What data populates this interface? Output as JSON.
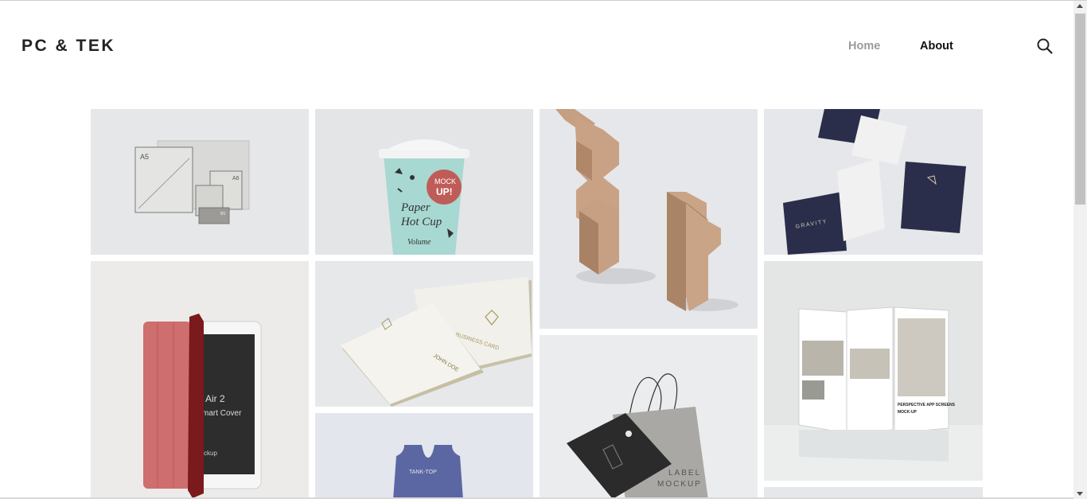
{
  "site": {
    "logo": "PC & TEK"
  },
  "nav": {
    "items": [
      {
        "label": "Home"
      },
      {
        "label": "About"
      }
    ]
  },
  "icons": {
    "search": "search-icon"
  },
  "gallery": {
    "items": [
      {
        "name": "stationery-mockup",
        "texts": [
          "A5",
          "A6",
          "B5"
        ]
      },
      {
        "name": "paper-cup-mockup",
        "texts": [
          "MOCK",
          "UP!",
          "Paper",
          "Hot Cup",
          "Volume"
        ]
      },
      {
        "name": "wood-blocks-mockup",
        "texts": []
      },
      {
        "name": "business-cards-navy-mockup",
        "texts": [
          "GRAVITY"
        ]
      },
      {
        "name": "tablet-smart-cover-mockup",
        "texts": [
          "Air 2",
          "mart Cover",
          "ckup"
        ]
      },
      {
        "name": "gold-business-card-mockup",
        "texts": [
          "BUSINESS CARD",
          "JOHN DOE"
        ]
      },
      {
        "name": "label-tag-mockup",
        "texts": [
          "LABEL",
          "MOCKUP"
        ]
      },
      {
        "name": "app-screens-mockup",
        "texts": [
          "PERSPECTIVE APP SCREENS",
          "MOCK-UP"
        ]
      },
      {
        "name": "tank-top-mockup",
        "texts": [
          "TANK-TOP"
        ]
      },
      {
        "name": "next-item-mockup",
        "texts": []
      }
    ]
  },
  "colors": {
    "nav_active": "#9a9a9a",
    "nav": "#111111",
    "tile_bg": "#e9eaec"
  }
}
